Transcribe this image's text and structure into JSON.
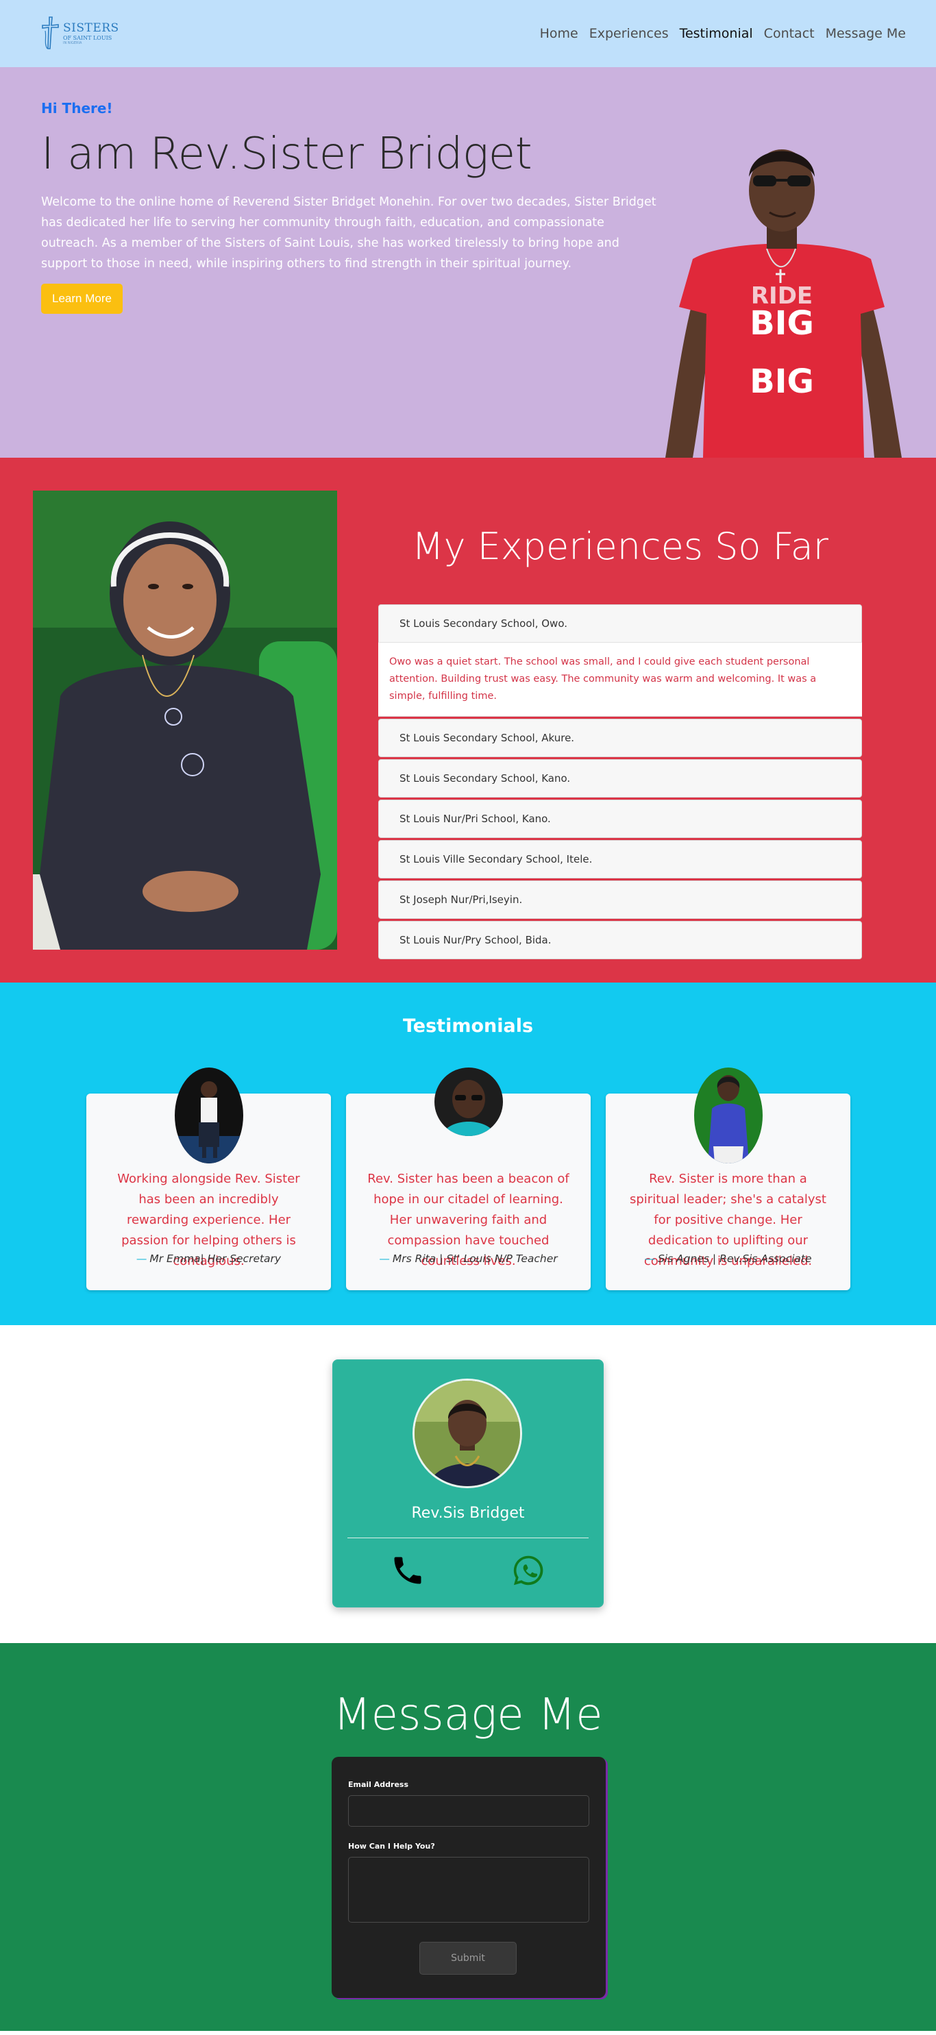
{
  "nav": {
    "logo": {
      "line1": "SISTERS",
      "line2": "OF SAINT LOUIS",
      "line3": "IN NIGERIA"
    },
    "links": [
      "Home",
      "Experiences",
      "Testimonial",
      "Contact",
      "Message Me"
    ],
    "active": "Testimonial"
  },
  "hero": {
    "greeting": "Hi There!",
    "title": "I am Rev.Sister Bridget",
    "description": "Welcome to the online home of Reverend Sister Bridget Monehin. For over two decades, Sister Bridget has dedicated her life to serving her community through faith, education, and compassionate outreach. As a member of the Sisters of Saint Louis, she has worked tirelessly to bring hope and support to those in need, while inspiring others to find strength in their spiritual journey.",
    "button": "Learn More",
    "shirt_text": [
      "RIDE",
      "BIG",
      "BIG"
    ]
  },
  "experiences": {
    "title": "My Experiences So Far",
    "items": [
      {
        "label": "St Louis Secondary School, Owo.",
        "body": "Owo was a quiet start. The school was small, and I could give each student personal attention. Building trust was easy. The community was warm and welcoming. It was a simple, fulfilling time."
      },
      {
        "label": "St Louis Secondary School, Akure."
      },
      {
        "label": "St Louis Secondary School, Kano."
      },
      {
        "label": "St Louis Nur/Pri School, Kano."
      },
      {
        "label": "St Louis Ville Secondary School, Itele."
      },
      {
        "label": "St Joseph Nur/Pri,Iseyin."
      },
      {
        "label": "St Louis Nur/Pry School, Bida."
      }
    ]
  },
  "testimonials": {
    "title": "Testimonials",
    "cards": [
      {
        "quote": "Working alongside Rev. Sister has been an incredibly rewarding experience. Her passion for helping others is contagious.",
        "author": "Mr Emma| Her Secretary"
      },
      {
        "quote": "Rev. Sister has been a beacon of hope in our citadel of learning. Her unwavering faith and compassion have touched countless lives.",
        "author": "Mrs Rita | St' Louis N/P Teacher"
      },
      {
        "quote": "Rev. Sister is more than a spiritual leader; she's a catalyst for positive change. Her dedication to uplifting our community is unparalleled.",
        "author": "Sis Agnes | Rev.Sis Associate"
      }
    ]
  },
  "contact": {
    "name": "Rev.Sis Bridget",
    "icons": [
      "phone-icon",
      "whatsapp-icon"
    ]
  },
  "message": {
    "title": "Message Me",
    "email_label": "Email Address",
    "email_value": "",
    "help_label": "How Can I Help You?",
    "help_value": "",
    "submit": "Submit"
  }
}
